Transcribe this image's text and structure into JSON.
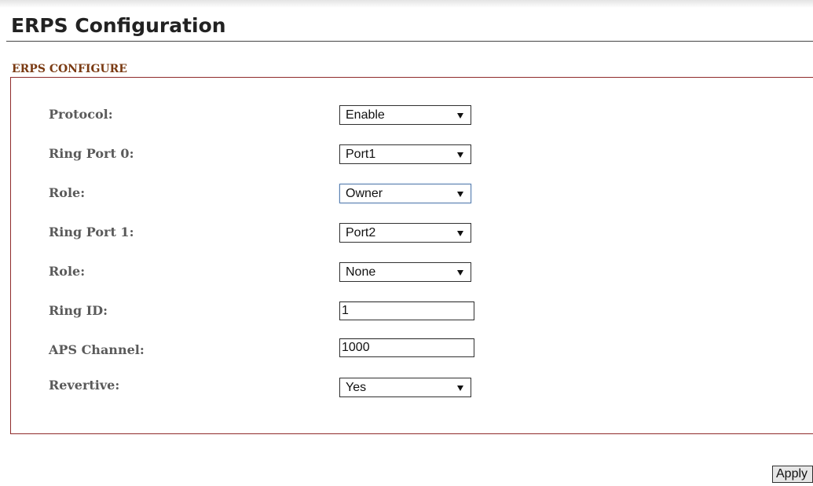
{
  "page": {
    "title": "ERPS Configuration"
  },
  "section": {
    "title": "ERPS CONFIGURE"
  },
  "fields": [
    {
      "label": "Protocol:",
      "type": "select",
      "value": "Enable"
    },
    {
      "label": "Ring Port 0:",
      "type": "select",
      "value": "Port1"
    },
    {
      "label": "Role:",
      "type": "select",
      "value": "Owner",
      "focused": true
    },
    {
      "label": "Ring Port 1:",
      "type": "select",
      "value": "Port2"
    },
    {
      "label": "Role:",
      "type": "select",
      "value": "None"
    },
    {
      "label": "Ring ID:",
      "type": "input",
      "value": "1"
    },
    {
      "label": "APS Channel:",
      "type": "input",
      "value": "1000"
    },
    {
      "label": "Revertive:",
      "type": "select",
      "value": "Yes"
    }
  ],
  "actions": {
    "apply_label": "Apply"
  },
  "colors": {
    "section_title": "#7a3a12",
    "box_border": "#8f2b2b",
    "label_text": "#5a5a5a"
  }
}
